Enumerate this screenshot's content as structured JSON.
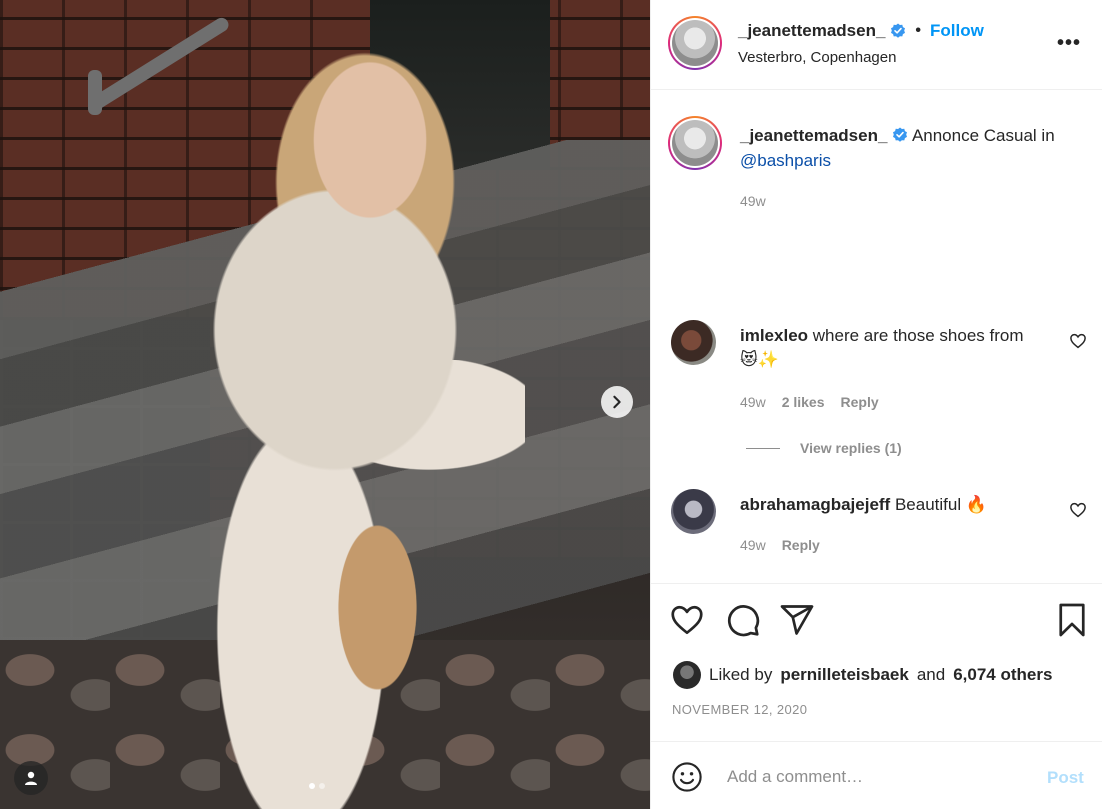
{
  "post": {
    "username": "_jeanettemadsen_",
    "separator": "•",
    "follow_label": "Follow",
    "location": "Vesterbro, Copenhagen",
    "more_label": "•••"
  },
  "caption": {
    "username": "_jeanettemadsen_",
    "text": "Annonce Casual in",
    "mention": "@bashparis",
    "time": "49w"
  },
  "comments": [
    {
      "username": "imlexleo",
      "text": "where are those shoes from 😻✨",
      "time": "49w",
      "likes": "2 likes",
      "reply_label": "Reply"
    },
    {
      "username": "abrahamagbajejeff",
      "text": "Beautiful 🔥",
      "time": "49w",
      "reply_label": "Reply"
    }
  ],
  "view_replies": "View replies (1)",
  "likes": {
    "prefix": "Liked by",
    "user": "pernilleteisbaek",
    "conjunction": "and",
    "others": "6,074 others"
  },
  "date": "NOVEMBER 12, 2020",
  "add_comment": {
    "placeholder": "Add a comment…",
    "post_label": "Post"
  },
  "colors": {
    "accent": "#0095f6",
    "post_disabled": "#b2dffc",
    "muted": "#8e8e8e"
  },
  "icons": [
    "verified-badge-icon",
    "chevron-right-icon",
    "user-tag-icon",
    "heart-icon",
    "comment-icon",
    "share-icon",
    "bookmark-icon",
    "emoji-icon"
  ]
}
